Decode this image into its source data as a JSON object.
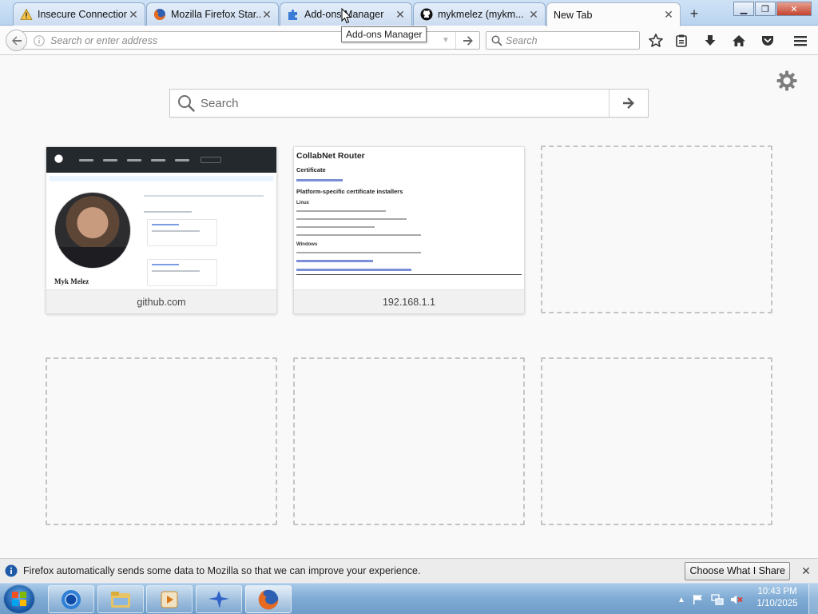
{
  "tabs": [
    {
      "title": "Insecure Connection",
      "icon": "warning-icon"
    },
    {
      "title": "Mozilla Firefox Star...",
      "icon": "firefox-icon"
    },
    {
      "title": "Add-ons Manager",
      "icon": "puzzle-piece-icon"
    },
    {
      "title": "mykmelez (mykm...",
      "icon": "github-icon"
    },
    {
      "title": "New Tab",
      "icon": ""
    }
  ],
  "tooltip": "Add-ons Manager",
  "urlbar": {
    "placeholder": "Search or enter address",
    "value": ""
  },
  "searchbar": {
    "placeholder": "Search",
    "value": ""
  },
  "newtab": {
    "search_placeholder": "Search",
    "tiles": [
      {
        "label": "github.com",
        "thumbnail": "github profile page"
      },
      {
        "label": "192.168.1.1",
        "thumbnail": "CollabNet Router page"
      },
      {
        "label": "",
        "thumbnail": ""
      },
      {
        "label": "",
        "thumbnail": ""
      },
      {
        "label": "",
        "thumbnail": ""
      },
      {
        "label": "",
        "thumbnail": ""
      }
    ],
    "thumb_github": {
      "name": "Myk Melez"
    },
    "thumb_collabnet": {
      "title": "CollabNet Router",
      "section1": "Certificate",
      "section2": "Platform-specific certificate installers",
      "linux": "Linux",
      "windows": "Windows"
    }
  },
  "notification": {
    "message": "Firefox automatically sends some data to Mozilla so that we can improve your experience.",
    "button": "Choose What I Share"
  },
  "taskbar": {
    "apps": [
      "chrome-icon",
      "file-explorer-icon",
      "media-player-icon",
      "bird-app-icon",
      "firefox-icon"
    ],
    "clock_time": "10:43 PM",
    "clock_date": "1/10/2025"
  },
  "colors": {
    "accent": "#0a84ff",
    "tabstrip": "#c6ddf4",
    "taskbar": "#7eaad3"
  }
}
